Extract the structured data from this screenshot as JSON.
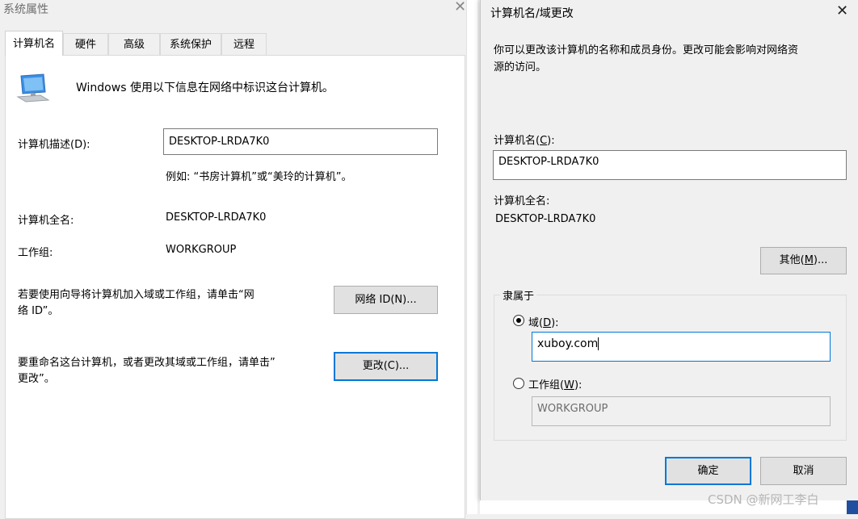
{
  "left_window": {
    "title": "系统属性",
    "tabs": [
      "计算机名",
      "硬件",
      "高级",
      "系统保护",
      "远程"
    ],
    "intro_text": "Windows 使用以下信息在网络中标识这台计算机。",
    "description_label": "计算机描述(D):",
    "description_value": "DESKTOP-LRDA7K0",
    "description_example": "例如: “书房计算机”或“美玲的计算机”。",
    "full_name_label": "计算机全名:",
    "full_name_value": "DESKTOP-LRDA7K0",
    "workgroup_label": "工作组:",
    "workgroup_value": "WORKGROUP",
    "network_id_text_line1": "若要使用向导将计算机加入域或工作组，请单击“网",
    "network_id_text_line2": "络 ID”。",
    "network_id_button": "网络 ID(N)...",
    "rename_text_line1": "要重命名这台计算机，或者更改其域或工作组，请单击”",
    "rename_text_line2": "更改”。",
    "change_button": "更改(C)..."
  },
  "right_dialog": {
    "title": "计算机名/域更改",
    "desc_line1": "你可以更改该计算机的名称和成员身份。更改可能会影响对网络资",
    "desc_line2": "源的访问。",
    "computer_name_label": "计算机名(",
    "computer_name_accel": "C",
    "computer_name_label_end": "):",
    "computer_name_value": "DESKTOP-LRDA7K0",
    "full_name_label": "计算机全名:",
    "full_name_value": "DESKTOP-LRDA7K0",
    "more_button_pre": "其他(",
    "more_button_accel": "M",
    "more_button_post": ")...",
    "member_of_label": "隶属于",
    "domain_radio_pre": "域(",
    "domain_radio_accel": "D",
    "domain_radio_post": "):",
    "domain_value": "xuboy.com",
    "workgroup_radio_pre": "工作组(",
    "workgroup_radio_accel": "W",
    "workgroup_radio_post": "):",
    "workgroup_value": "WORKGROUP",
    "ok_button": "确定",
    "cancel_button": "取消"
  },
  "watermark": "CSDN @新网工李白",
  "colors": {
    "focus_blue": "#0078d7",
    "window_bg": "#f0f0f0",
    "panel_bg": "#ffffff"
  }
}
